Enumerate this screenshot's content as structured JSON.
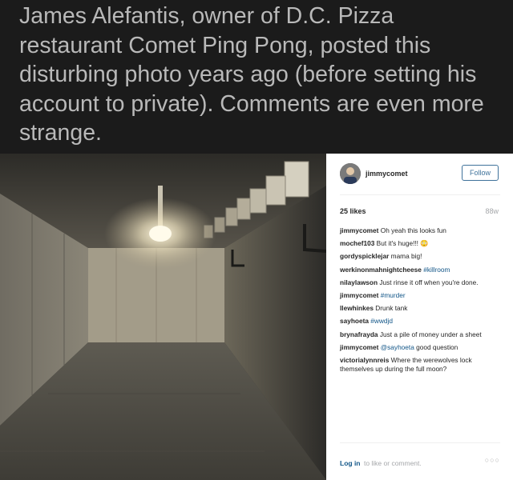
{
  "headline": "James Alefantis, owner of D.C. Pizza restaurant Comet Ping Pong, posted this disturbing photo years ago (before setting his account to private). Comments are even more strange.",
  "post": {
    "username": "jimmycomet",
    "follow_label": "Follow",
    "likes": "25 likes",
    "age": "88w",
    "comments": [
      {
        "user": "jimmycomet",
        "text": "Oh yeah this looks fun"
      },
      {
        "user": "mochef103",
        "text": "But it's huge!!! 😳"
      },
      {
        "user": "gordyspicklejar",
        "text": "mama big!"
      },
      {
        "user": "werkinonmahnightcheese",
        "tag": "#killroom"
      },
      {
        "user": "nilaylawson",
        "text": "Just rinse it off when you're done."
      },
      {
        "user": "jimmycomet",
        "tag": "#murder"
      },
      {
        "user": "llewhinkes",
        "text": "Drunk tank"
      },
      {
        "user": "sayhoeta",
        "tag": "#wwdjd"
      },
      {
        "user": "brynafrayda",
        "text": "Just a pile of money under a sheet"
      },
      {
        "user": "jimmycomet",
        "tag": "@sayhoeta",
        "text": "good question"
      },
      {
        "user": "victorialynnreis",
        "text": "Where the werewolves lock themselves up during the full moon?"
      }
    ],
    "login_label": "Log in",
    "login_rest": "to like or comment.",
    "more_icon": "more-options-icon"
  },
  "colors": {
    "background": "#1b1b1b",
    "headline_text": "#b9b9b9",
    "link_blue": "#125688",
    "follow_blue": "#3f729b",
    "muted_gray": "#a5a7aa"
  }
}
